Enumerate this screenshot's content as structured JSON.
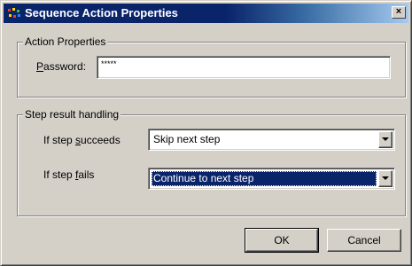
{
  "window": {
    "title": "Sequence Action Properties",
    "close_symbol": "×",
    "title_icon": "sequence-app-icon"
  },
  "action_properties": {
    "group_label": "Action Properties",
    "password_label_pre": "",
    "password_label_underline": "P",
    "password_label_post": "assword:",
    "password_value": "*****"
  },
  "step_result": {
    "group_label": "Step result handling",
    "succeeds_label_pre": "If step ",
    "succeeds_label_underline": "s",
    "succeeds_label_post": "ucceeds",
    "succeeds_value": "Skip next step",
    "fails_label_pre": "If step ",
    "fails_label_underline": "f",
    "fails_label_post": "ails",
    "fails_value": "Continue to next step"
  },
  "buttons": {
    "ok": "OK",
    "cancel": "Cancel"
  },
  "colors": {
    "titlebar_start": "#0a246a",
    "titlebar_end": "#a6caf0",
    "face": "#d4d0c8",
    "selection": "#0a246a"
  }
}
